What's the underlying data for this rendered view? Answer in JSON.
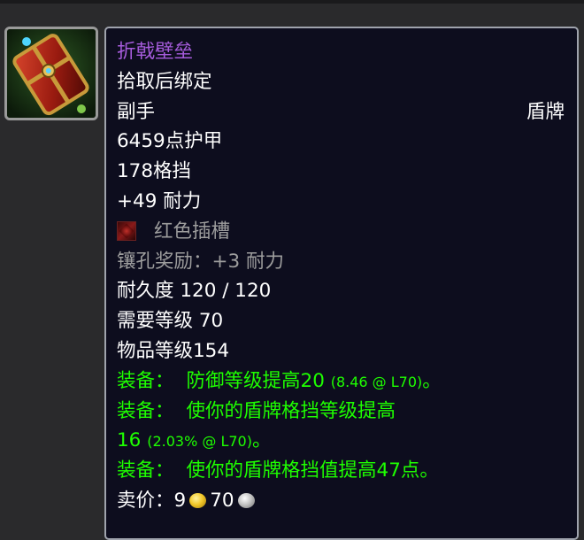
{
  "item": {
    "icon": "shield-item-icon",
    "name": "折戟壁垒",
    "binding": "拾取后绑定",
    "slot": "副手",
    "type": "盾牌",
    "armor": "6459点护甲",
    "block": "178格挡",
    "stamina": "+49 耐力",
    "socket": {
      "icon": "red-socket-icon",
      "label": "红色插槽"
    },
    "socket_bonus": "镶孔奖励：+3 耐力",
    "durability": "耐久度 120 / 120",
    "required_level": "需要等级 70",
    "item_level": "物品等级154",
    "equip": [
      {
        "prefix": "装备：",
        "text": "防御等级提高20",
        "note": "(8.46 @ L70)",
        "suffix": "。"
      },
      {
        "prefix": "装备：",
        "text": "使你的盾牌格挡等级提高",
        "text2": "16",
        "note": "(2.03% @ L70)",
        "suffix": "。"
      },
      {
        "prefix": "装备：",
        "text": "使你的盾牌格挡值提高47点。"
      }
    ],
    "sell_price": {
      "label": "卖价：",
      "gold": "9",
      "silver": "70"
    }
  },
  "colors": {
    "epic": "#a65cdc",
    "equip_green": "#1eff00",
    "disabled_gray": "#9d9d9d",
    "tooltip_bg": "#0d0d1e",
    "tooltip_border": "#9fa3ad"
  }
}
